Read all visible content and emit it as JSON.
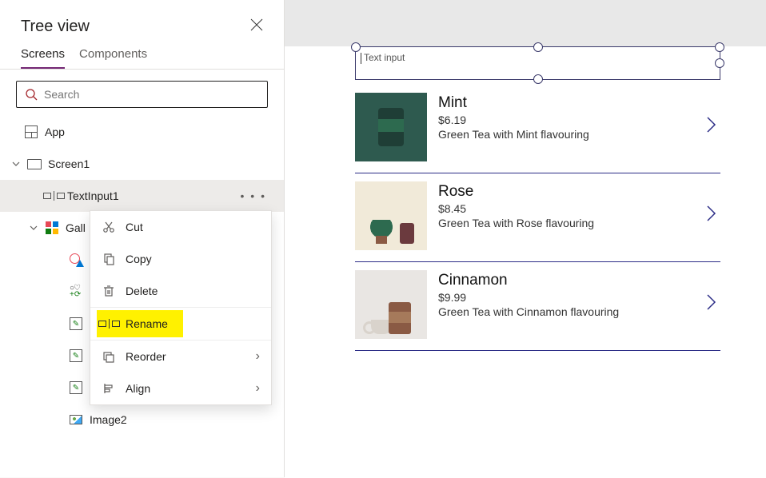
{
  "panel": {
    "title": "Tree view",
    "tabs": {
      "screens": "Screens",
      "components": "Components"
    },
    "search_placeholder": "Search"
  },
  "tree": {
    "app": "App",
    "screen1": "Screen1",
    "textinput1": "TextInput1",
    "gallery": "Gall",
    "image2": "Image2"
  },
  "context_menu": {
    "cut": "Cut",
    "copy": "Copy",
    "delete": "Delete",
    "rename": "Rename",
    "reorder": "Reorder",
    "align": "Align"
  },
  "canvas": {
    "textinput_placeholder": "Text input"
  },
  "products": [
    {
      "title": "Mint",
      "price": "$6.19",
      "desc": "Green Tea with Mint flavouring"
    },
    {
      "title": "Rose",
      "price": "$8.45",
      "desc": "Green Tea with Rose flavouring"
    },
    {
      "title": "Cinnamon",
      "price": "$9.99",
      "desc": "Green Tea with Cinnamon flavouring"
    }
  ]
}
